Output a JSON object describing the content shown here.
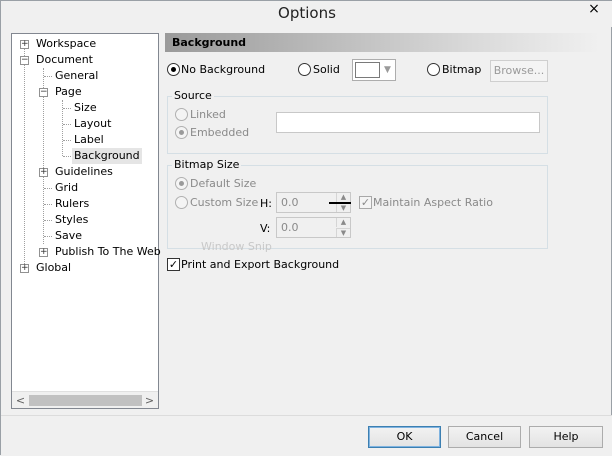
{
  "window": {
    "title": "Options",
    "close": "×"
  },
  "tree": {
    "items": [
      {
        "label": "Workspace",
        "expander": "+"
      },
      {
        "label": "Document",
        "expander": "−"
      },
      {
        "label": "General"
      },
      {
        "label": "Page",
        "expander": "−"
      },
      {
        "label": "Size"
      },
      {
        "label": "Layout"
      },
      {
        "label": "Label"
      },
      {
        "label": "Background",
        "selected": true
      },
      {
        "label": "Guidelines",
        "expander": "+"
      },
      {
        "label": "Grid"
      },
      {
        "label": "Rulers"
      },
      {
        "label": "Styles"
      },
      {
        "label": "Save"
      },
      {
        "label": "Publish To The Web",
        "expander": "+"
      },
      {
        "label": "Global",
        "expander": "+"
      }
    ],
    "scroll_left": "<",
    "scroll_right": ">"
  },
  "panel": {
    "header": "Background",
    "type_options": {
      "no_background": "No Background",
      "solid": "Solid",
      "bitmap": "Bitmap",
      "browse": "Browse...",
      "selected": "No Background",
      "solid_color": "#ffffff"
    },
    "source": {
      "title": "Source",
      "linked": "Linked",
      "embedded": "Embedded",
      "selected": "Embedded",
      "path_value": ""
    },
    "bitmap_size": {
      "title": "Bitmap Size",
      "default_size": "Default Size",
      "custom_size": "Custom Size",
      "selected": "Default Size",
      "h_label": "H:",
      "v_label": "V:",
      "h_value": "0.0",
      "v_value": "0.0",
      "maintain_aspect": "Maintain Aspect Ratio",
      "maintain_checked": true
    },
    "print_export": {
      "label": "Print and Export Background",
      "checked": true
    },
    "ghost_text": "Window Snip"
  },
  "buttons": {
    "ok": "OK",
    "cancel": "Cancel",
    "help": "Help"
  },
  "glyphs": {
    "check": "✓",
    "up": "▲",
    "down": "▼",
    "dropdown": "▼"
  }
}
